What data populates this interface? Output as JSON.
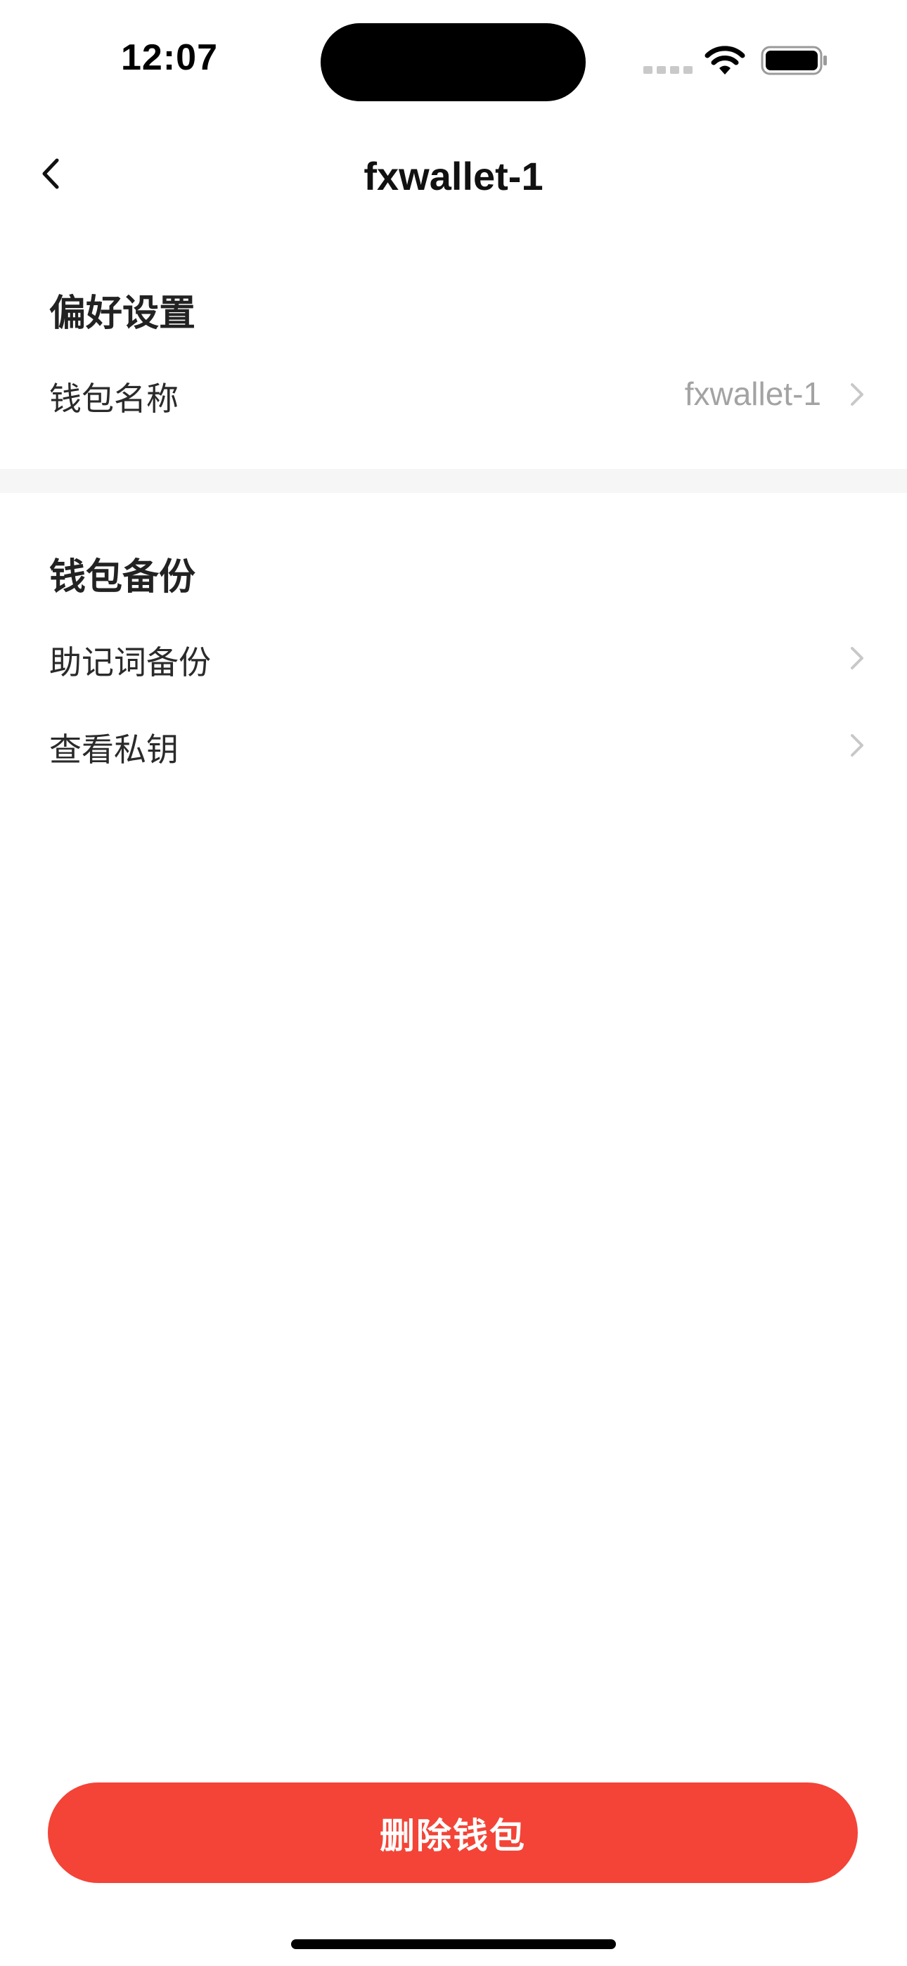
{
  "status_bar": {
    "time": "12:07",
    "icons": [
      "cellular-signal-icon",
      "wifi-icon",
      "battery-icon"
    ]
  },
  "nav": {
    "back_icon": "chevron-left-icon",
    "title": "fxwallet-1"
  },
  "preferences": {
    "title": "偏好设置",
    "wallet_name_label": "钱包名称",
    "wallet_name_value": "fxwallet-1"
  },
  "backup": {
    "title": "钱包备份",
    "mnemonic_label": "助记词备份",
    "private_key_label": "查看私钥"
  },
  "actions": {
    "delete_label": "删除钱包"
  },
  "colors": {
    "delete_button": "#f34437",
    "section_divider": "#f6f6f6",
    "secondary_text": "#a3a3a3",
    "chevron": "#c8c8c8"
  }
}
